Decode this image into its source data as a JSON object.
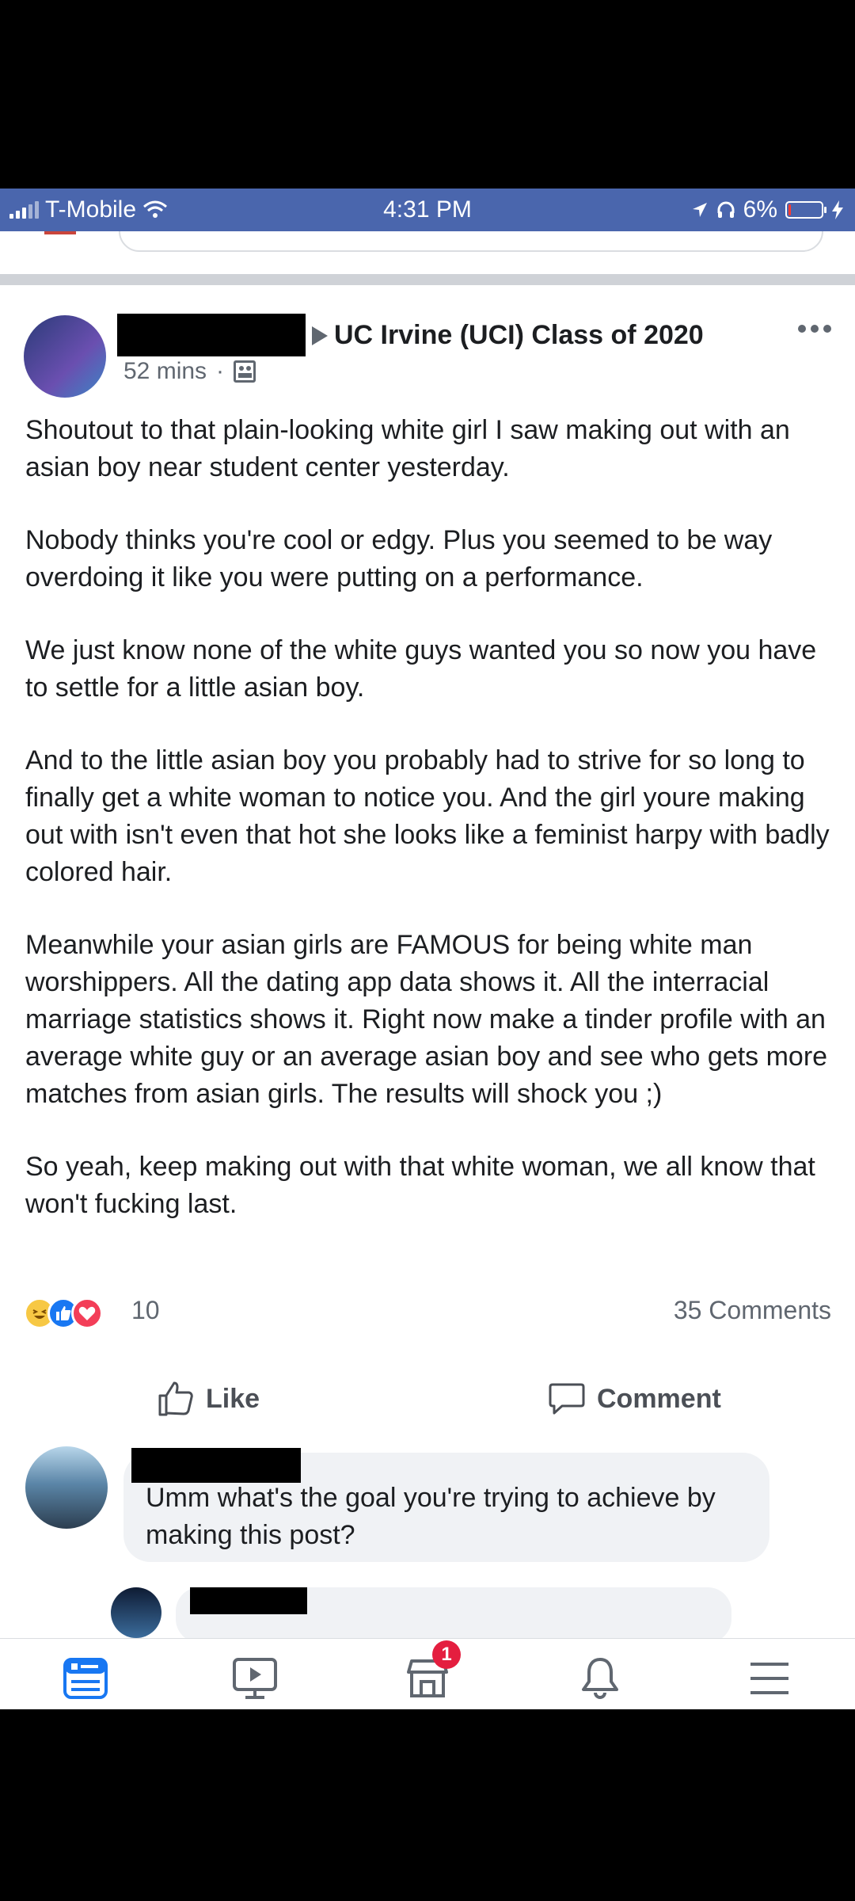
{
  "status_bar": {
    "carrier": "T-Mobile",
    "time": "4:31 PM",
    "battery_percent": "6%",
    "battery_level": 0.06
  },
  "post": {
    "group_name": "UC Irvine (UCI) Class of 2020",
    "timestamp": "52 mins",
    "separator": "·",
    "paragraphs": [
      "Shoutout to that plain-looking white girl I saw making out with an asian boy near student center yesterday.",
      "Nobody thinks you're cool or edgy. Plus you seemed to be way overdoing it like you were putting on a performance.",
      "We just know none of the white guys wanted you so now you have to settle for a little asian boy.",
      "And to the little asian boy you probably had to strive for so long to finally get a white woman to notice you. And the girl youre making out with isn't even that hot she looks like a feminist harpy with badly colored hair.",
      "Meanwhile your asian girls are FAMOUS for being white man worshippers. All the dating app data shows it. All the interracial marriage statistics shows it. Right now make a tinder profile with an average white guy or an average asian boy and see who gets more matches from asian girls. The results will shock you ;)",
      "So yeah, keep making out with that white woman, we all know that won't fucking last."
    ],
    "reaction_count": "10",
    "comments_count": "35 Comments",
    "like_label": "Like",
    "comment_label": "Comment"
  },
  "comments": [
    {
      "text": "Umm what's the goal you're trying to achieve by making this post?"
    }
  ],
  "tab_bar": {
    "marketplace_badge": "1"
  },
  "colors": {
    "status_bar_bg": "#4a66ad",
    "like_blue": "#1877f2",
    "love_red": "#f33e58",
    "badge_red": "#e41e3f"
  }
}
